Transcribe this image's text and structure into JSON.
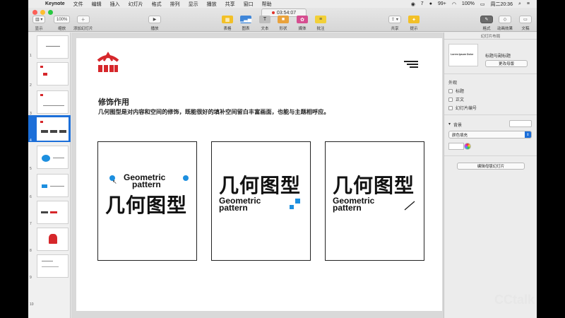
{
  "menubar": {
    "items": [
      "Keynote",
      "文件",
      "编辑",
      "插入",
      "幻灯片",
      "格式",
      "排列",
      "显示",
      "播放",
      "共享",
      "窗口",
      "帮助"
    ],
    "status": {
      "weibo": "7",
      "qq": "99+",
      "battery": "100%",
      "clock": "周二20:36"
    }
  },
  "timer": "03:54:07",
  "toolbar": {
    "view": "显示",
    "zoom_value": "100%",
    "zoom": "缩放",
    "add_slide": "添加幻灯片",
    "play": "播放",
    "table": "表格",
    "chart": "图表",
    "text": "文本",
    "shape": "形状",
    "media": "媒体",
    "comment": "批注",
    "share": "共享",
    "tips": "提示",
    "format": "格式",
    "animate": "动画效果",
    "document": "文稿"
  },
  "navigator": {
    "numbers": [
      "1",
      "2",
      "3",
      "4",
      "5",
      "6",
      "7",
      "8",
      "9",
      "10"
    ]
  },
  "slide": {
    "title": "修饰作用",
    "body": "几何图型是对内容和空间的修饰，既能很好的填补空间留白丰富画面，也能与主题相呼应。",
    "card_cn": "几何图型",
    "card_en_1": "Geometric",
    "card_en_2": "pattern",
    "accent": "#1d8fdf",
    "logo_color": "#d6272b"
  },
  "inspector": {
    "header": "幻灯片布局",
    "layout_name": "标题与副标题",
    "change_master": "更改母版",
    "layout_thumb_text": "Lorem Ipsum Dolor",
    "appearance": "外观",
    "opt_title": "标题",
    "opt_body": "正文",
    "opt_slide_number": "幻灯片编号",
    "background": "背景",
    "fill_type": "颜色填充",
    "edit_master": "编辑母版幻灯片"
  },
  "watermark": "CCtalk"
}
